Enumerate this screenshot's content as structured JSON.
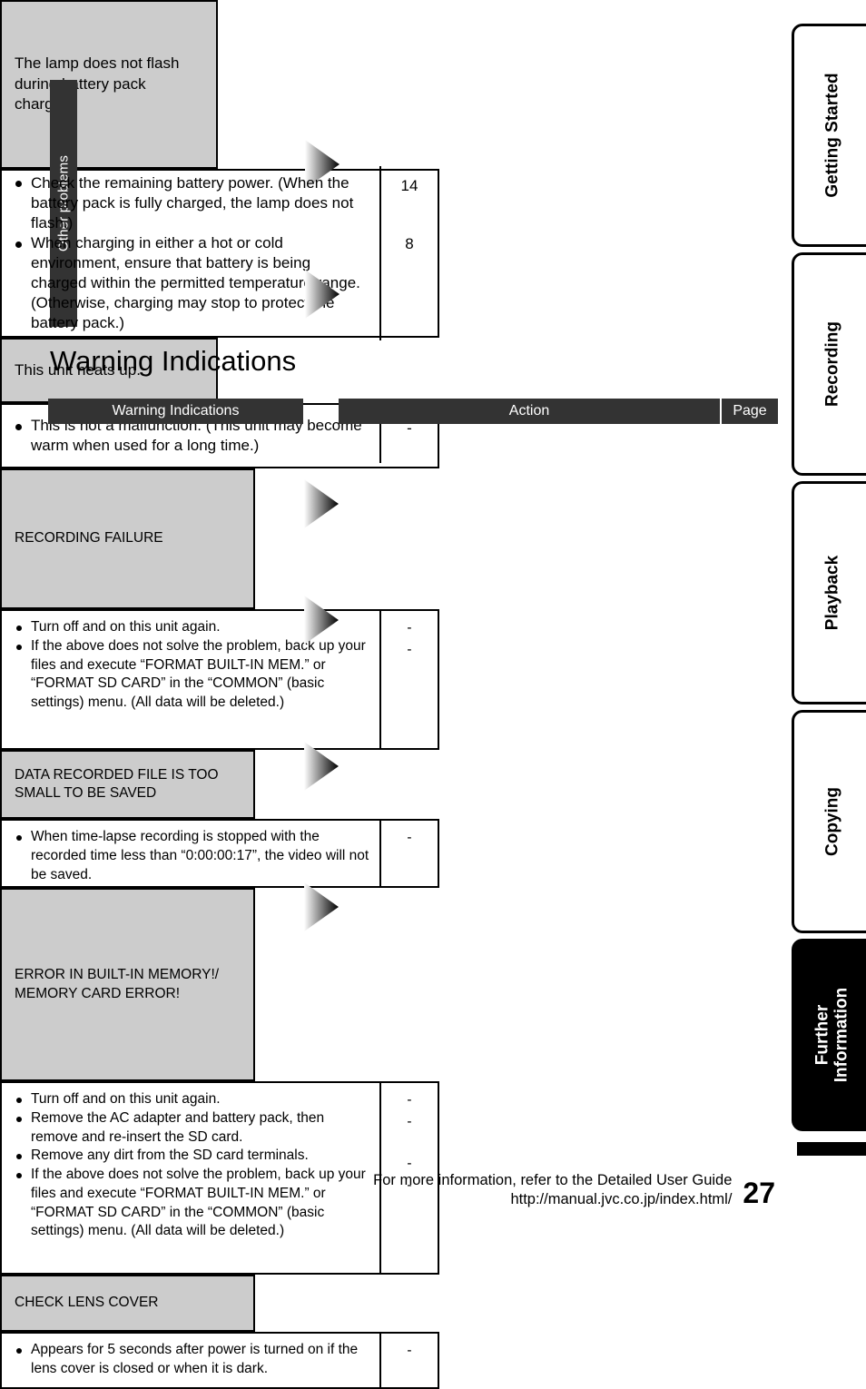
{
  "troubleshoot": {
    "section_label": "Other problems",
    "rows": [
      {
        "problem": "The lamp does not flash during battery pack charging.",
        "actions": [
          "Check the remaining battery power. (When the battery pack is fully charged, the lamp does not flash.)",
          "When charging in either a hot or cold environment, ensure that battery is being charged within the permitted temperature range. (Otherwise, charging may stop to protect the battery pack.)"
        ],
        "pages": [
          "14",
          "8"
        ]
      },
      {
        "problem": "This unit heats up.",
        "actions": [
          "This is not a malfunction. (This unit may become warm when used for a long time.)"
        ],
        "pages": [
          "-"
        ]
      }
    ]
  },
  "warning_section": {
    "heading": "Warning Indications",
    "headers": {
      "indication": "Warning Indications",
      "action": "Action",
      "page": "Page"
    },
    "rows": [
      {
        "indication": "RECORDING FAILURE",
        "actions": [
          "Turn off and on this unit again.",
          "If the above does not solve the problem, back up your files and execute “FORMAT BUILT-IN MEM.” or “FORMAT SD CARD” in the “COMMON” (basic settings) menu. (All data will be deleted.)"
        ],
        "pages": [
          "-",
          "-"
        ]
      },
      {
        "indication": "DATA RECORDED FILE IS TOO SMALL TO BE SAVED",
        "actions": [
          "When time-lapse recording is stopped with the recorded time less than “0:00:00:17”, the video will not be saved."
        ],
        "pages": [
          "-"
        ]
      },
      {
        "indication": "ERROR IN BUILT-IN MEMORY!/ MEMORY CARD ERROR!",
        "actions": [
          "Turn off and on this unit again.",
          "Remove the AC adapter and battery pack, then remove and re-insert the SD card.",
          "Remove any dirt from the SD card terminals.",
          "If the above does not solve the problem, back up your files and execute “FORMAT BUILT-IN MEM.” or “FORMAT SD CARD” in the “COMMON” (basic settings) menu. (All data will be deleted.)"
        ],
        "pages": [
          "-",
          "-",
          "-",
          "-"
        ]
      },
      {
        "indication": "CHECK LENS COVER",
        "actions": [
          "Appears for 5 seconds after power is turned on if the lens cover is closed or when it is dark."
        ],
        "pages": [
          "-"
        ]
      }
    ]
  },
  "side_tabs": [
    {
      "label": "Getting Started",
      "active": false
    },
    {
      "label": "Recording",
      "active": false
    },
    {
      "label": "Playback",
      "active": false
    },
    {
      "label": "Copying",
      "active": false
    },
    {
      "label": "Further\nInformation",
      "active": true
    }
  ],
  "footer": {
    "line1": "For more information, refer to the Detailed User Guide",
    "line2": "http://manual.jvc.co.jp/index.html/",
    "page_number": "27"
  },
  "colors": {
    "header_dark": "#333333",
    "cell_grey": "#cccccc",
    "ink": "#000000",
    "paper": "#ffffff"
  }
}
